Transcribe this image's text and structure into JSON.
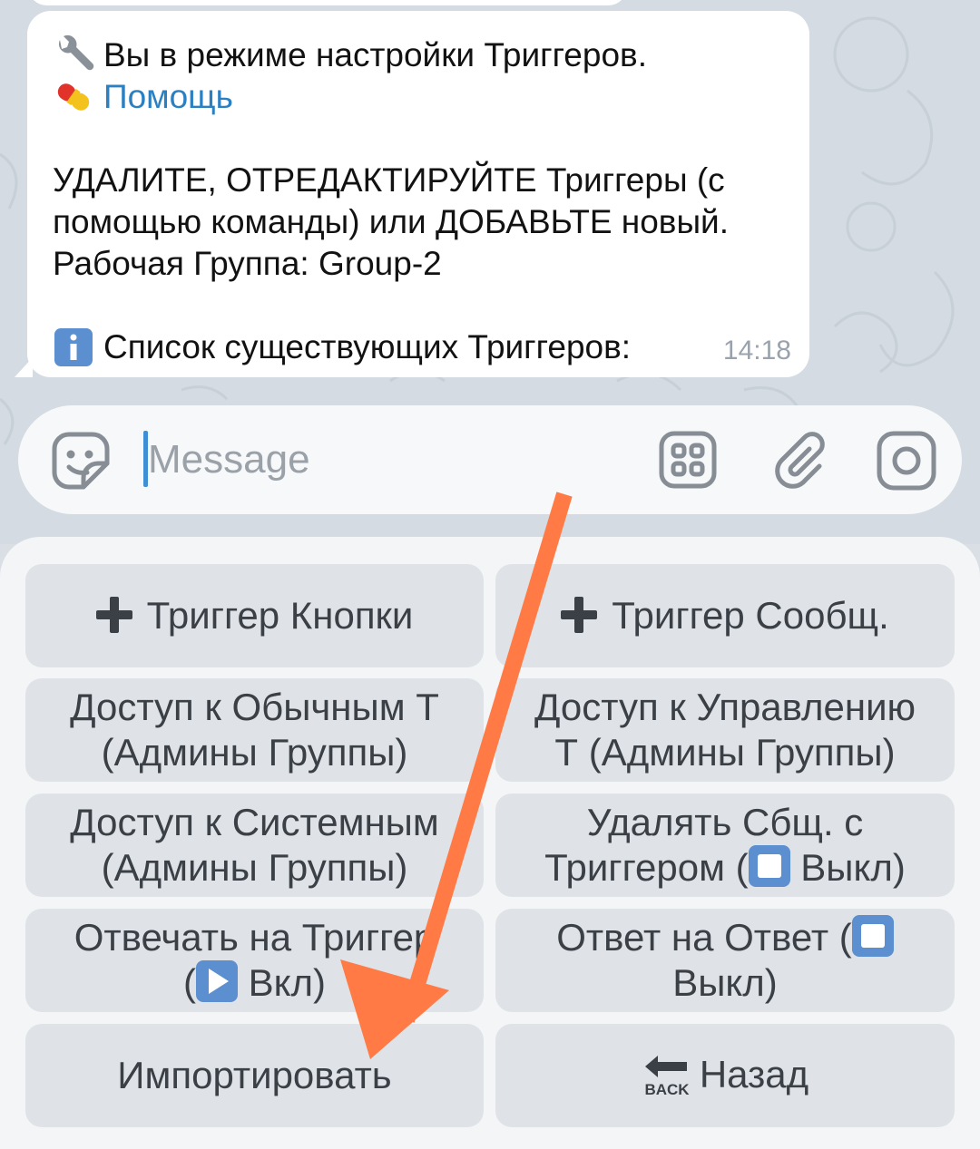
{
  "chat": {
    "message": {
      "line1_icon": "wrench-icon",
      "line1_text": "Вы в режиме настройки Триггеров.",
      "line2_icon": "pill-icon",
      "line2_link": "Помощь",
      "paragraph_line1": "УДАЛИТЕ, ОТРЕДАКТИРУЙТЕ Триггеры (с",
      "paragraph_line2": "помощью команды) или ДОБАВЬТЕ новый.",
      "paragraph_line3": "Рабочая Группа: Group-2",
      "list_icon": "info-icon",
      "list_text": "Список существующих Триггеров:",
      "time": "14:18"
    }
  },
  "composer": {
    "placeholder": "Message",
    "icons": [
      "sticker-icon",
      "apps-icon",
      "paperclip-icon",
      "camera-icon"
    ]
  },
  "keyboard": {
    "buttons": [
      {
        "icon": "plus-icon",
        "label": "Триггер Кнопки"
      },
      {
        "icon": "plus-icon",
        "label": "Триггер Сообщ."
      },
      {
        "line1": "Доступ к Обычным Т",
        "line2": "(Админы Группы)"
      },
      {
        "line1": "Доступ к Управлению",
        "line2": "Т (Админы Группы)"
      },
      {
        "line1": "Доступ к Системным",
        "line2": "(Админы Группы)"
      },
      {
        "line1": "Удалять Сбщ. с",
        "line2_before": "Триггером (",
        "line2_icon": "stop-icon",
        "line2_after": " Выкл)"
      },
      {
        "line1": "Отвечать на Триггер",
        "line2_before": "(",
        "line2_icon": "play-icon",
        "line2_after": " Вкл)"
      },
      {
        "line1_before": "Ответ на Ответ (",
        "line1_icon": "stop-icon",
        "line2": "Выкл)"
      },
      {
        "label": "Импортировать"
      },
      {
        "icon": "back-icon",
        "label": "Назад",
        "icon_text": "BACK"
      }
    ]
  },
  "annotation": {
    "color": "#ff7a45",
    "icon": "arrow-icon"
  }
}
